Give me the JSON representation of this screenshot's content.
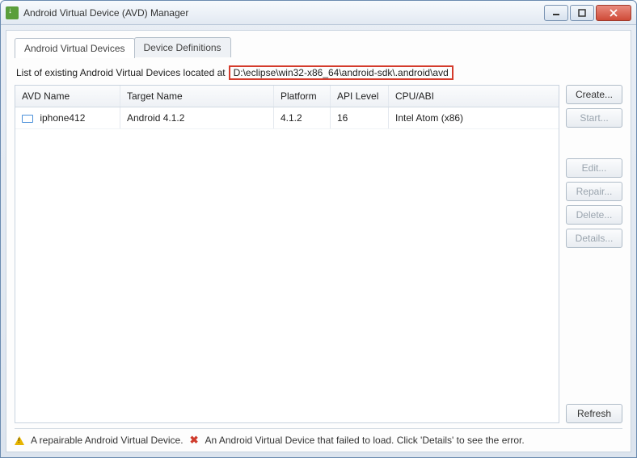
{
  "window": {
    "title": "Android Virtual Device (AVD) Manager"
  },
  "tabs": {
    "avd": "Android Virtual Devices",
    "defs": "Device Definitions"
  },
  "intro": {
    "prefix": "List of existing Android Virtual Devices located at",
    "path": "D:\\eclipse\\win32-x86_64\\android-sdk\\.android\\avd"
  },
  "columns": {
    "name": "AVD Name",
    "target": "Target Name",
    "platform": "Platform",
    "api": "API Level",
    "cpu": "CPU/ABI"
  },
  "rows": [
    {
      "name": "iphone412",
      "target": "Android 4.1.2",
      "platform": "4.1.2",
      "api": "16",
      "cpu": "Intel Atom (x86)"
    }
  ],
  "buttons": {
    "create": "Create...",
    "start": "Start...",
    "edit": "Edit...",
    "repair": "Repair...",
    "delete": "Delete...",
    "details": "Details...",
    "refresh": "Refresh"
  },
  "footer": {
    "repairable": "A repairable Android Virtual Device.",
    "failed": "An Android Virtual Device that failed to load. Click 'Details' to see the error."
  }
}
